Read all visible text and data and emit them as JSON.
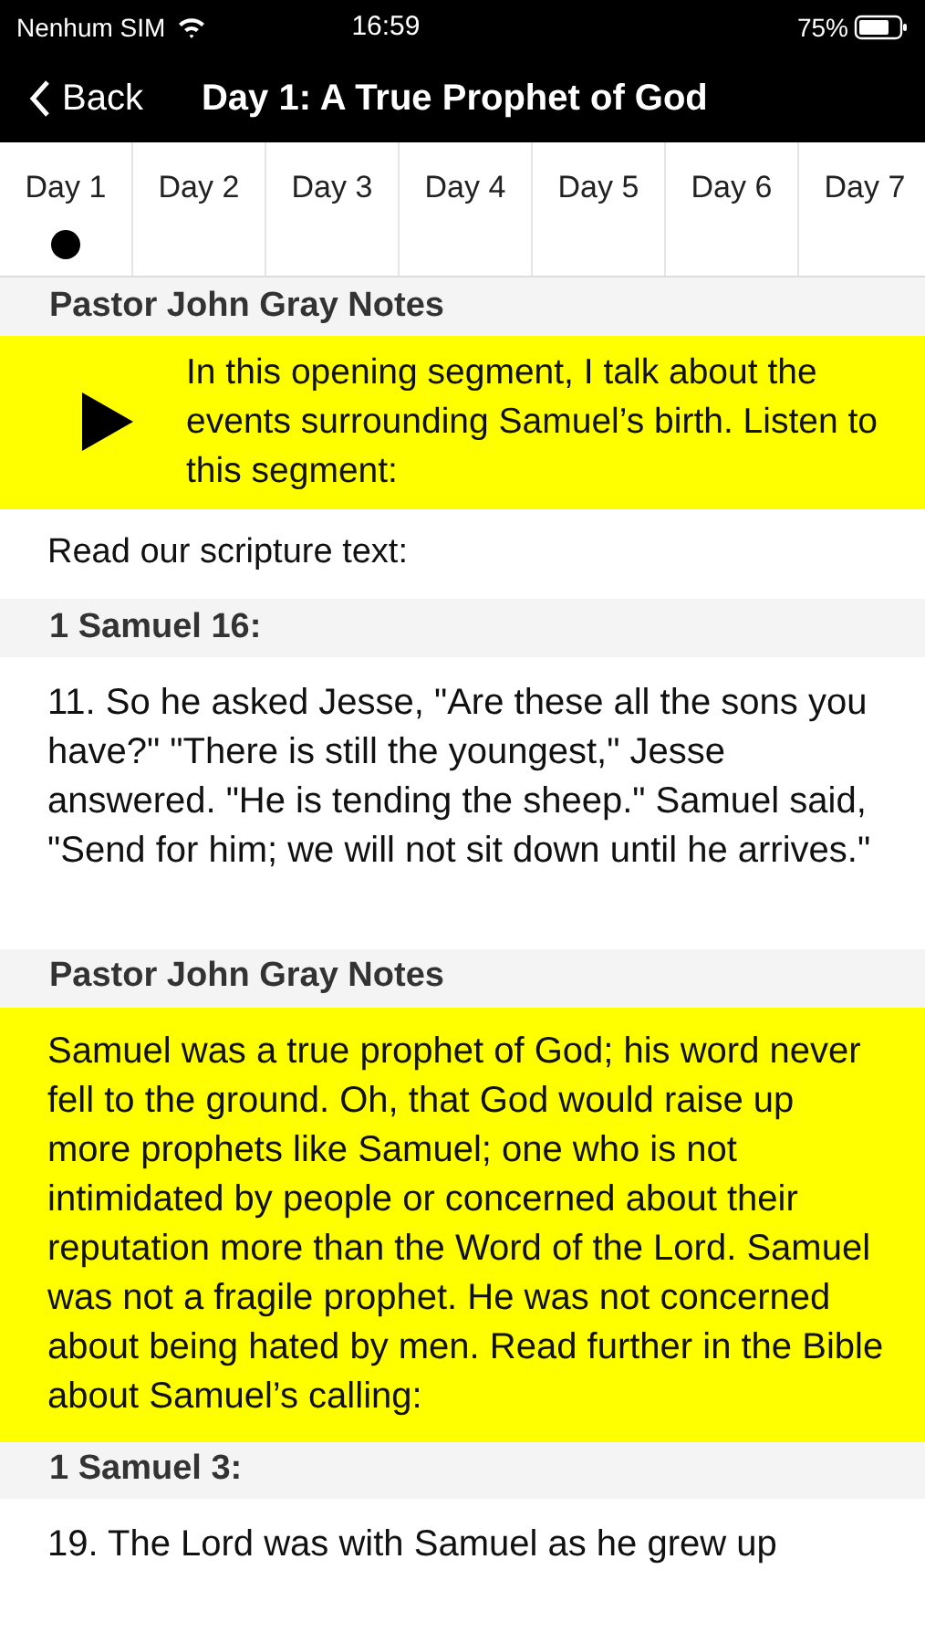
{
  "status_bar": {
    "carrier": "Nenhum SIM",
    "time": "16:59",
    "battery": "75%"
  },
  "nav": {
    "back": "Back",
    "title": "Day 1: A True Prophet of God"
  },
  "tabs": [
    {
      "label": "Day 1",
      "selected": true
    },
    {
      "label": "Day 2",
      "selected": false
    },
    {
      "label": "Day 3",
      "selected": false
    },
    {
      "label": "Day 4",
      "selected": false
    },
    {
      "label": "Day 5",
      "selected": false
    },
    {
      "label": "Day 6",
      "selected": false
    },
    {
      "label": "Day 7",
      "selected": false
    }
  ],
  "sections": [
    {
      "kind": "header",
      "text": "Pastor John Gray Notes"
    },
    {
      "kind": "audio",
      "text": "In this opening segment, I talk about the events surrounding Samuel’s birth. Listen to this segment:"
    },
    {
      "kind": "plain",
      "text": "Read our scripture text:"
    },
    {
      "kind": "header",
      "text": "1 Samuel 16:"
    },
    {
      "kind": "verse",
      "text": "11. So he asked Jesse, \"Are these all the sons you have?\" \"There is still the youngest,\" Jesse answered. \"He is tending the sheep.\" Samuel said, \"Send for him; we will not sit down until he arrives.\""
    },
    {
      "kind": "header",
      "text": "Pastor John Gray Notes"
    },
    {
      "kind": "note",
      "text": "Samuel was a true prophet of God; his word never fell to the ground. Oh, that God would raise up more prophets like Samuel; one who is not intimidated by people or concerned about their reputation more than the Word of the Lord. Samuel was not a fragile prophet. He was not concerned about being hated by men. Read further in the Bible about Samuel’s calling:"
    },
    {
      "kind": "header",
      "text": "1 Samuel 3:"
    },
    {
      "kind": "verse",
      "text": "19. The Lord was with Samuel as he grew up"
    }
  ]
}
